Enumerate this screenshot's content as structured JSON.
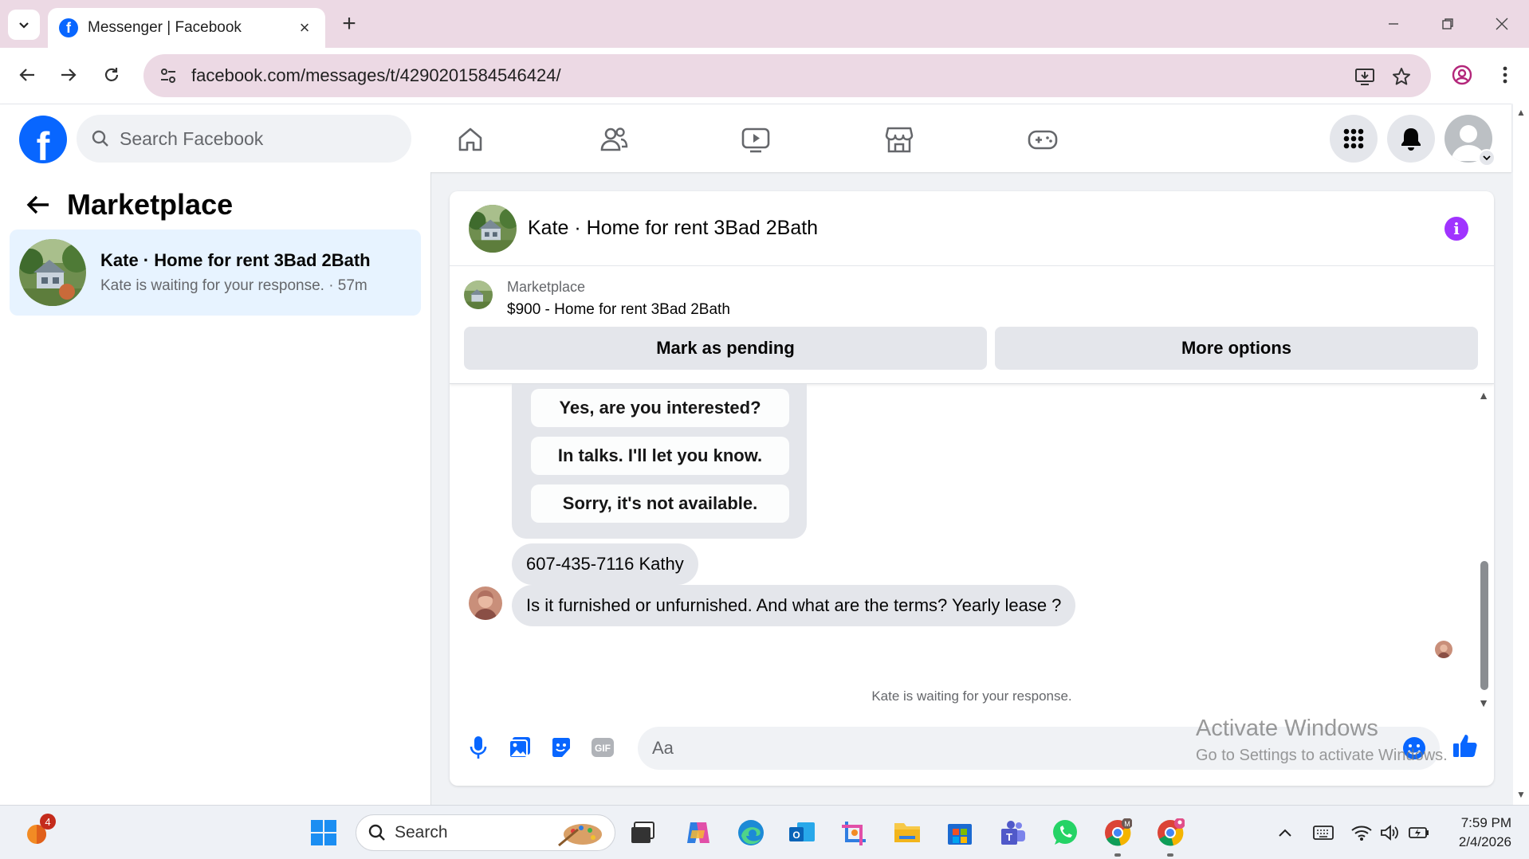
{
  "browser": {
    "tab_title": "Messenger | Facebook",
    "url": "facebook.com/messages/t/4290201584546424/"
  },
  "facebook": {
    "search_placeholder": "Search Facebook",
    "nav_icons": [
      "home-icon",
      "friends-icon",
      "video-icon",
      "marketplace-icon",
      "gaming-icon"
    ]
  },
  "left_panel": {
    "title": "Marketplace",
    "conversation": {
      "name": "Kate · Home for rent 3Bad 2Bath",
      "preview": "Kate is waiting for your response. · 57m"
    }
  },
  "chat": {
    "title": "Kate · Home for rent 3Bad 2Bath",
    "listing": {
      "label": "Marketplace",
      "price_title": "$900 - Home for rent 3Bad 2Bath",
      "mark_pending_label": "Mark as pending",
      "more_options_label": "More options"
    },
    "quick_replies": [
      "Yes, are you interested?",
      "In talks. I'll let you know.",
      "Sorry, it's not available."
    ],
    "messages": [
      {
        "text": "607-435-7116 Kathy"
      },
      {
        "text": "Is it furnished or unfurnished.  And what are the terms? Yearly lease ?"
      }
    ],
    "status": "Kate is waiting for your response.",
    "composer_placeholder": "Aa",
    "accent_color": "#0866ff"
  },
  "watermark": {
    "line1": "Activate Windows",
    "line2": "Go to Settings to activate Windows."
  },
  "taskbar": {
    "search_label": "Search",
    "widget_badge": "4",
    "time": "7:59 PM",
    "date": "2/4/2026"
  }
}
